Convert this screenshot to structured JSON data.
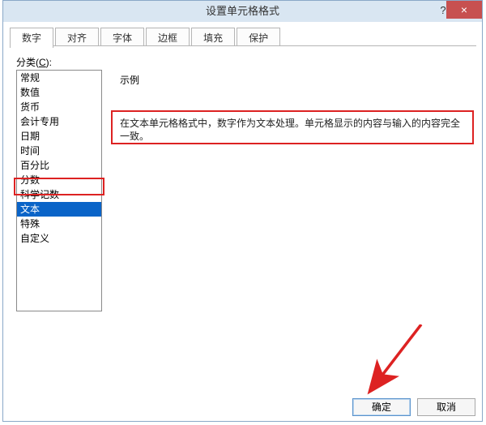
{
  "window": {
    "title": "设置单元格格式",
    "help": "?",
    "close": "×"
  },
  "tabs": [
    {
      "label": "数字",
      "active": true
    },
    {
      "label": "对齐",
      "active": false
    },
    {
      "label": "字体",
      "active": false
    },
    {
      "label": "边框",
      "active": false
    },
    {
      "label": "填充",
      "active": false
    },
    {
      "label": "保护",
      "active": false
    }
  ],
  "category": {
    "label_prefix": "分类(",
    "label_accel": "C",
    "label_suffix": "):",
    "items": [
      "常规",
      "数值",
      "货币",
      "会计专用",
      "日期",
      "时间",
      "百分比",
      "分数",
      "科学记数",
      "文本",
      "特殊",
      "自定义"
    ],
    "selected_index": 9
  },
  "right": {
    "example_label": "示例",
    "description": "在文本单元格格式中，数字作为文本处理。单元格显示的内容与输入的内容完全一致。"
  },
  "buttons": {
    "ok": "确定",
    "cancel": "取消"
  }
}
